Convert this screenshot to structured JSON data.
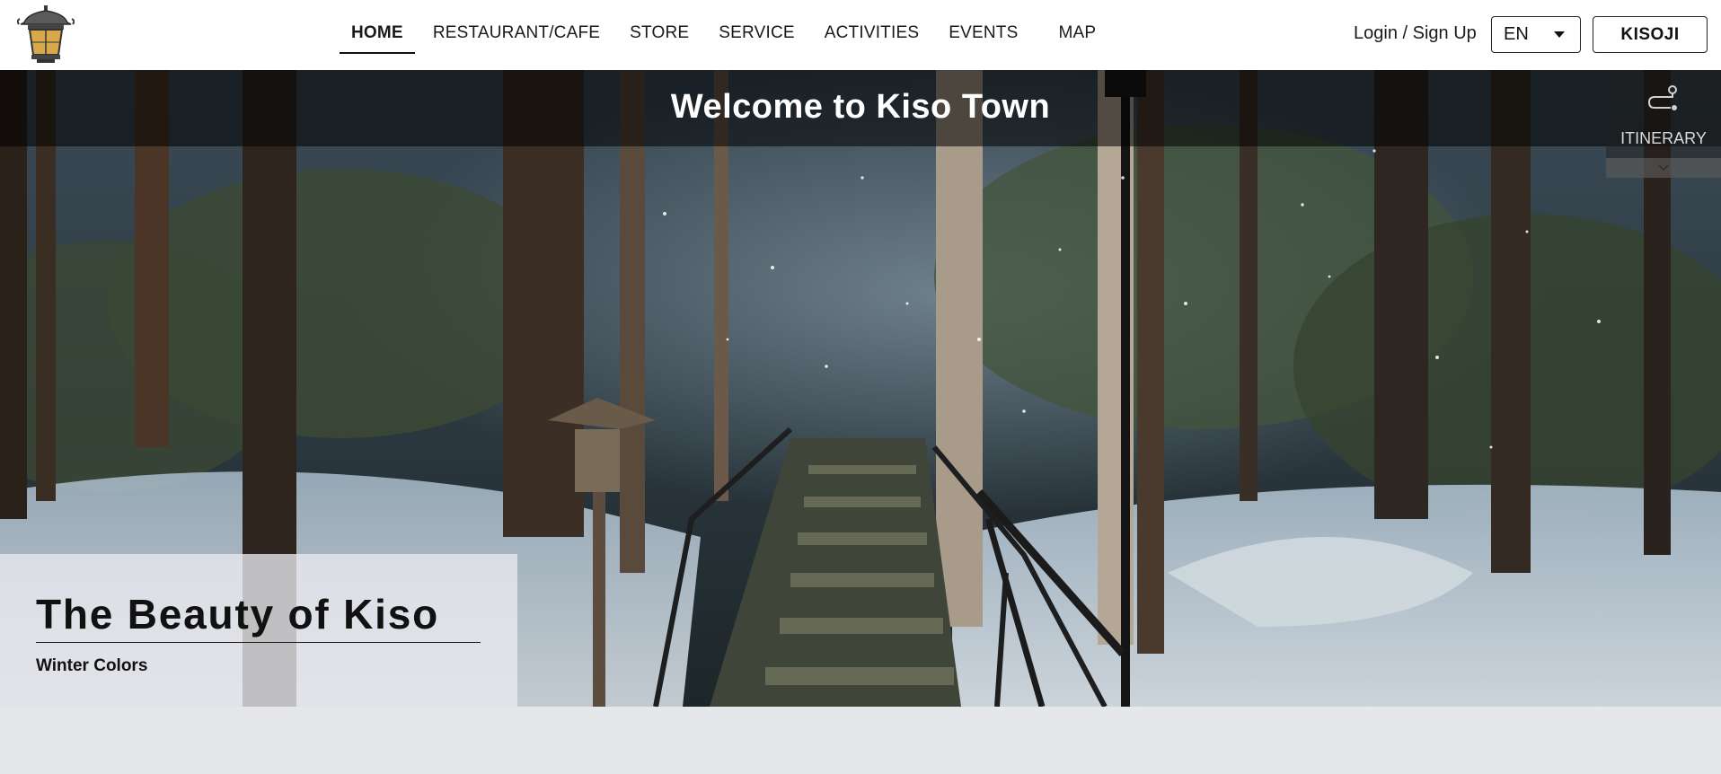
{
  "header": {
    "logo_icon": "lantern-icon",
    "nav": [
      {
        "label": "HOME",
        "active": true
      },
      {
        "label": "RESTAURANT/CAFE"
      },
      {
        "label": "STORE"
      },
      {
        "label": "SERVICE"
      },
      {
        "label": "ACTIVITIES"
      },
      {
        "label": "EVENTS"
      },
      {
        "label": "MAP"
      }
    ],
    "login_label": "Login / Sign Up",
    "language": "EN",
    "kisoji_label": "KISOJI"
  },
  "hero": {
    "title": "Welcome to Kiso Town",
    "itinerary_label": "ITINERARY",
    "feature_title": "The Beauty of Kiso",
    "feature_subtitle": "Winter Colors"
  }
}
